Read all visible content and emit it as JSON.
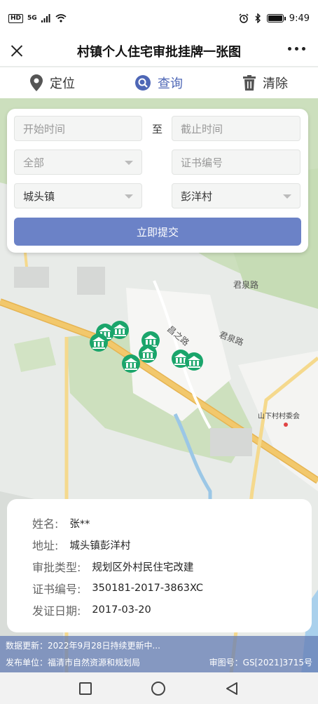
{
  "status": {
    "hd": "HD",
    "signal": "5G",
    "time": "9:49"
  },
  "header": {
    "title": "村镇个人住宅审批挂牌一张图"
  },
  "toolbar": {
    "locate": "定位",
    "query": "查询",
    "clear": "清除"
  },
  "form": {
    "start_placeholder": "开始时间",
    "to_label": "至",
    "end_placeholder": "截止时间",
    "type_select": "全部",
    "cert_placeholder": "证书编号",
    "town_select": "城头镇",
    "village_select": "彭洋村",
    "submit": "立即提交"
  },
  "map": {
    "road1": "君泉路",
    "road2": "君泉路",
    "road3": "昌之路",
    "poi": "山下村村委会"
  },
  "info": {
    "name_label": "姓名:",
    "name_value": "张**",
    "address_label": "地址:",
    "address_value": "城头镇彭洋村",
    "type_label": "审批类型:",
    "type_value": "规划区外村民住宅改建",
    "cert_label": "证书编号:",
    "cert_value": "350181-2017-3863XC",
    "date_label": "发证日期:",
    "date_value": "2017-03-20"
  },
  "footer": {
    "update": "数据更新：2022年9月28日持续更新中...",
    "publisher": "发布单位：福清市自然资源和规划局",
    "approval": "审图号：GS[2021]3715号"
  },
  "colors": {
    "accent": "#6b82c7",
    "marker": "#1aa56b",
    "park": "#c9dfb8",
    "road": "#f0c060"
  }
}
